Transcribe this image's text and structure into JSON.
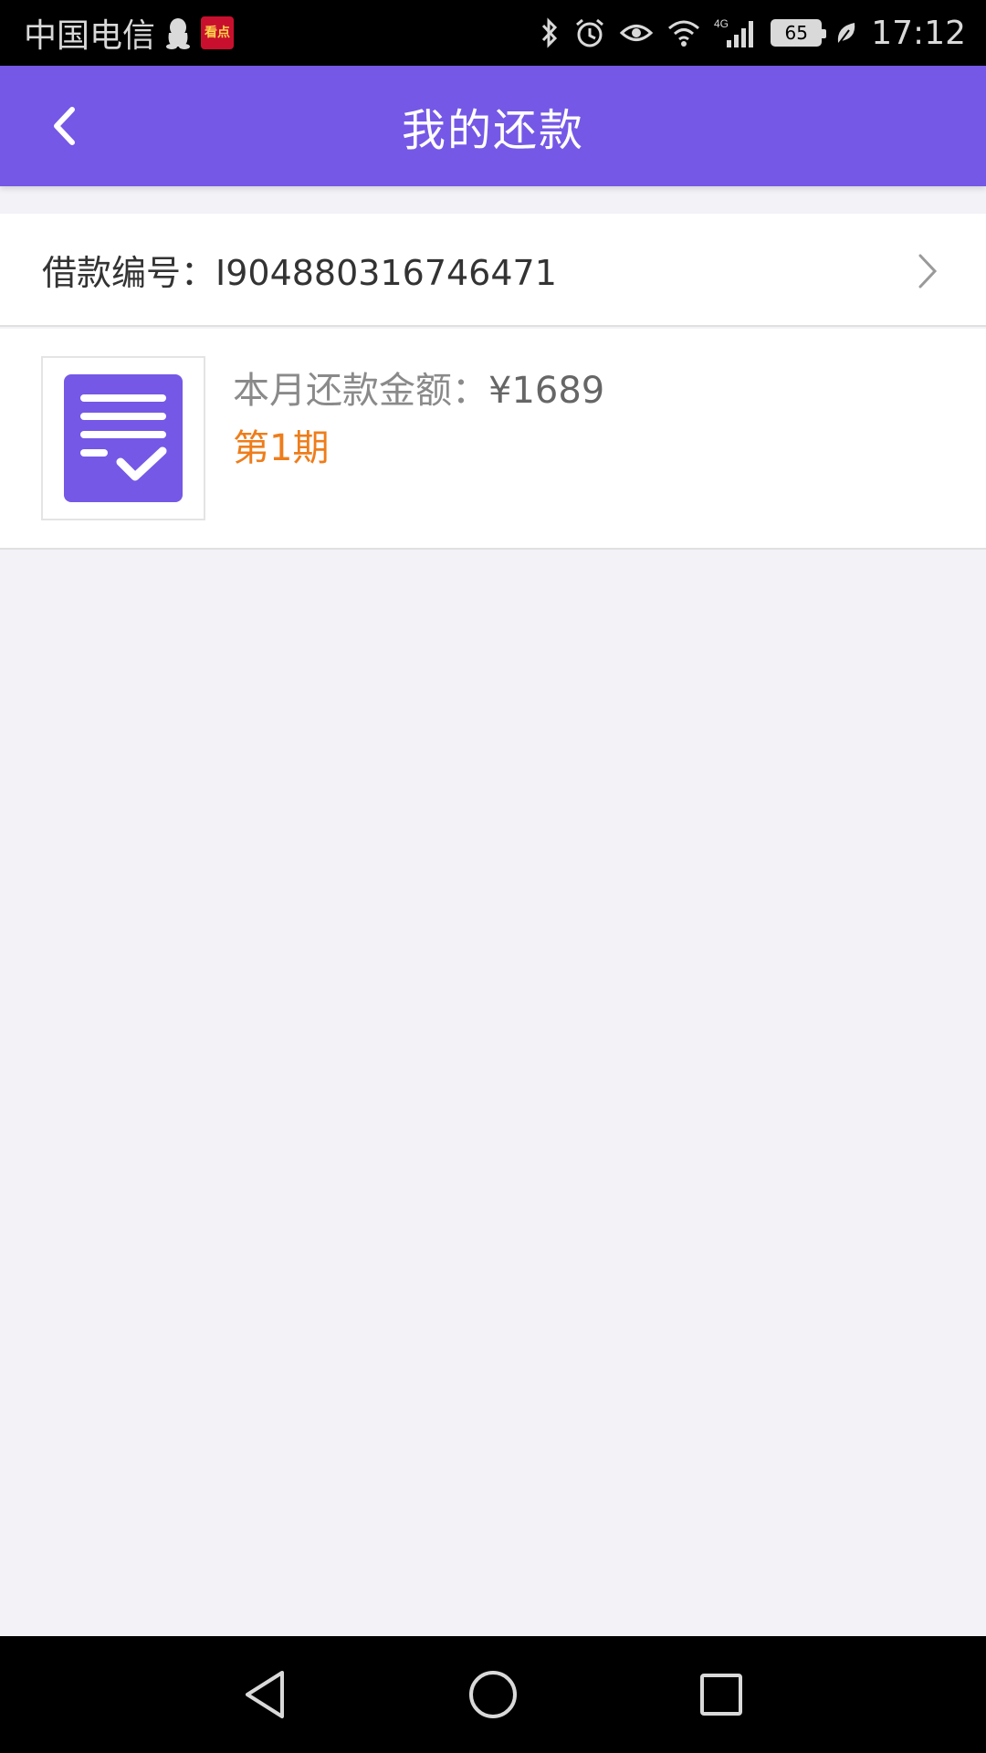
{
  "status_bar": {
    "carrier": "中国电信",
    "news_app_label": "看点",
    "battery_level": "65",
    "time": "17:12",
    "network_type": "4G",
    "icons": [
      "qq-penguin-icon",
      "news-app-icon",
      "bluetooth-icon",
      "alarm-icon",
      "eye-comfort-icon",
      "wifi-icon",
      "signal-icon",
      "battery-icon",
      "power-saving-leaf-icon"
    ]
  },
  "app_bar": {
    "title": "我的还款",
    "back_icon": "chevron-left-icon",
    "color": "#7558e6"
  },
  "loan": {
    "label": "借款编号：",
    "number": "I904880316746471",
    "chevron_icon": "chevron-right-icon"
  },
  "repayment": {
    "amount_label": "本月还款金额：",
    "amount_value": "¥1689",
    "period": "第1期",
    "icon": "document-check-icon",
    "period_color": "#ee7d1b"
  },
  "nav_bar": {
    "icons": [
      "nav-back-icon",
      "nav-home-icon",
      "nav-recents-icon"
    ]
  }
}
